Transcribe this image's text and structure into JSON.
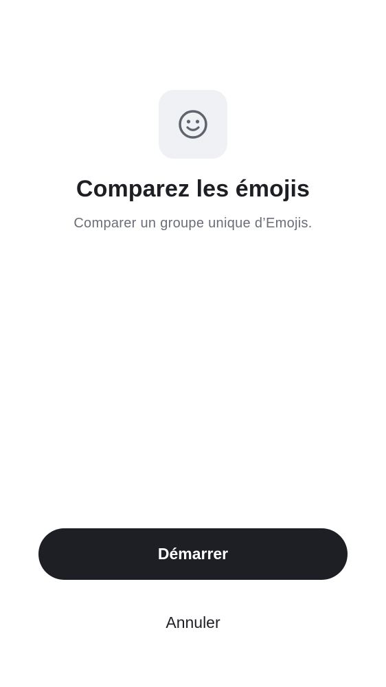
{
  "header": {
    "icon": "smiley-face-icon",
    "title": "Comparez les émojis",
    "subtitle": "Comparer un groupe unique d’Emojis."
  },
  "actions": {
    "start_label": "Démarrer",
    "cancel_label": "Annuler"
  },
  "colors": {
    "background": "#ffffff",
    "icon_tile": "#f0f1f5",
    "icon": "#5f636d",
    "primary_button": "#1e1f24",
    "primary_text": "#1e1f24",
    "secondary_text": "#6b6e78"
  }
}
